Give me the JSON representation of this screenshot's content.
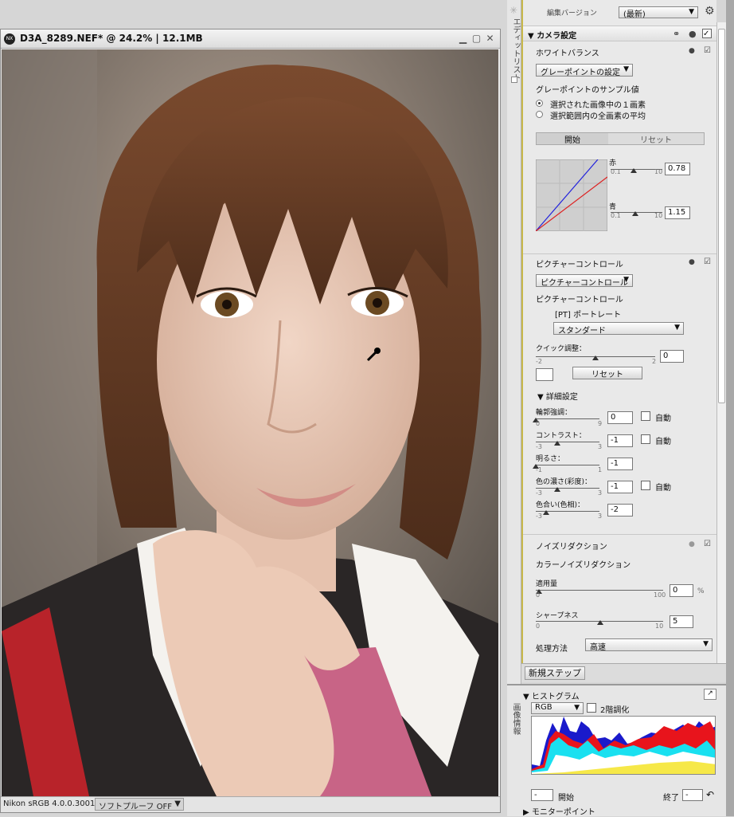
{
  "image_window": {
    "title": "D3A_8289.NEF* @ 24.2% | 12.1MB",
    "status_profile": "Nikon sRGB 4.0.0.3001",
    "softproof": "ソフトプルーフ OFF"
  },
  "side_tabs": {
    "edit_list": "エディットリスト",
    "image_info": "画像情報"
  },
  "panel": {
    "edit_version_label": "編集バージョン",
    "edit_version_value": "(最新)",
    "camera_settings": "カメラ設定",
    "white_balance": {
      "title": "ホワイトバランス",
      "mode": "グレーポイントの設定",
      "sample_label": "グレーポイントのサンプル値",
      "option1": "選択された画像中の１画素",
      "option2": "選択範囲内の全画素の平均",
      "start_btn": "開始",
      "reset_btn": "リセット",
      "red_label": "赤",
      "red_min": "0.1",
      "red_max": "10",
      "red_value": "0.78",
      "blue_label": "青",
      "blue_min": "0.1",
      "blue_max": "10",
      "blue_value": "1.15"
    },
    "picture_control": {
      "title": "ピクチャーコントロール",
      "mode": "ピクチャーコントロール",
      "sub_label": "ピクチャーコントロール",
      "preset": "[PT] ポートレート",
      "base": "スタンダード",
      "quick_label": "クイック調整：",
      "quick_min": "-2",
      "quick_max": "2",
      "quick_value": "0",
      "reset_btn": "リセット",
      "detail_label": "詳細設定",
      "auto_label": "自動",
      "sliders": [
        {
          "label": "輪郭強調：",
          "min": "0",
          "max": "9",
          "value": "0",
          "auto": true
        },
        {
          "label": "コントラスト：",
          "min": "-3",
          "max": "3",
          "value": "-1",
          "auto": true
        },
        {
          "label": "明るさ：",
          "min": "-1",
          "max": "1",
          "value": "-1",
          "auto": false
        },
        {
          "label": "色の濃さ(彩度)：",
          "min": "-3",
          "max": "3",
          "value": "-1",
          "auto": true
        },
        {
          "label": "色合い(色相)：",
          "min": "-3",
          "max": "3",
          "value": "-2",
          "auto": false
        }
      ]
    },
    "noise": {
      "title": "ノイズリダクション",
      "color_nr": "カラーノイズリダクション",
      "amount_label": "適用量",
      "amount_min": "0",
      "amount_max": "100",
      "amount_value": "0",
      "amount_unit": "%",
      "sharp_label": "シャープネス",
      "sharp_min": "0",
      "sharp_max": "10",
      "sharp_value": "5",
      "method_label": "処理方法",
      "method_value": "高速"
    }
  },
  "new_step": "新規ステップ",
  "histogram": {
    "title": "ヒストグラム",
    "channel": "RGB",
    "two_tone": "2階調化",
    "start_label": "開始",
    "end_label": "終了",
    "start_value": "-",
    "end_value": "-"
  },
  "monitor_point": "モニターポイント",
  "colors": {
    "accent": "#c8b84a",
    "histogram_red": "#e8141c",
    "histogram_blue": "#1a1acb",
    "histogram_cyan": "#19e0f0"
  }
}
